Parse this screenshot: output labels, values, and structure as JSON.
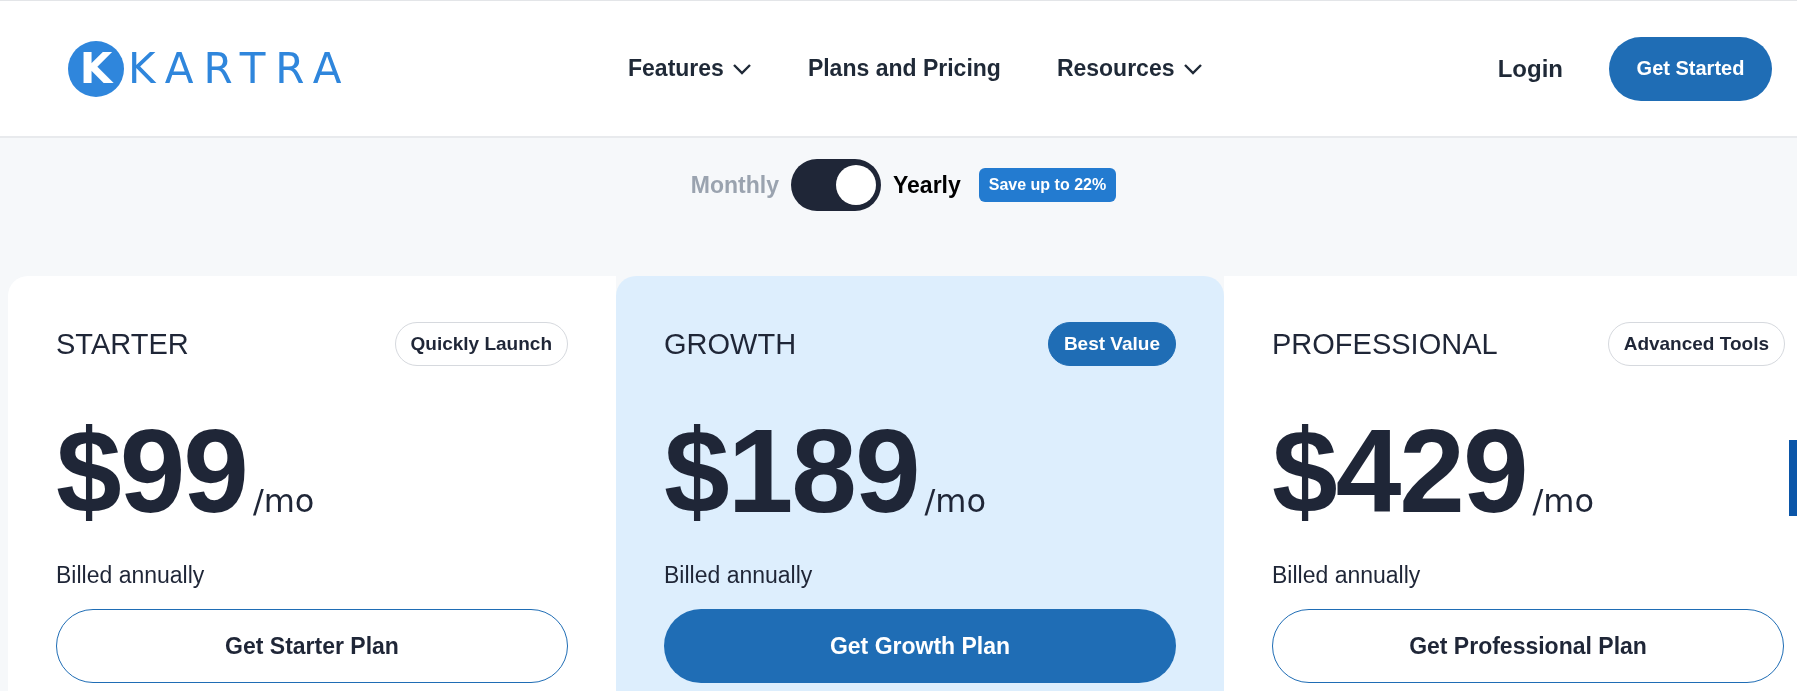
{
  "header": {
    "logo": {
      "mark": "K",
      "wordmark": "KARTRA"
    },
    "nav": [
      {
        "label": "Features",
        "dropdown": true
      },
      {
        "label": "Plans and Pricing",
        "dropdown": false
      },
      {
        "label": "Resources",
        "dropdown": true
      }
    ],
    "login": "Login",
    "cta": "Get Started"
  },
  "billing": {
    "options": [
      {
        "label": "Monthly",
        "selected": false
      },
      {
        "label": "Yearly",
        "selected": true
      }
    ],
    "toggle_on": true,
    "badge": "Save up to 22%"
  },
  "plans": [
    {
      "name": "STARTER",
      "badge": "Quickly Launch",
      "price": "$99",
      "period": "/mo",
      "note": "Billed annually",
      "button": "Get Starter Plan",
      "featured": false
    },
    {
      "name": "GROWTH",
      "badge": "Best Value",
      "price": "$189",
      "period": "/mo",
      "note": "Billed annually",
      "button": "Get Growth Plan",
      "featured": true
    },
    {
      "name": "PROFESSIONAL",
      "badge": "Advanced Tools",
      "price": "$429",
      "period": "/mo",
      "note": "Billed annually",
      "button": "Get Professional Plan",
      "featured": false
    }
  ]
}
